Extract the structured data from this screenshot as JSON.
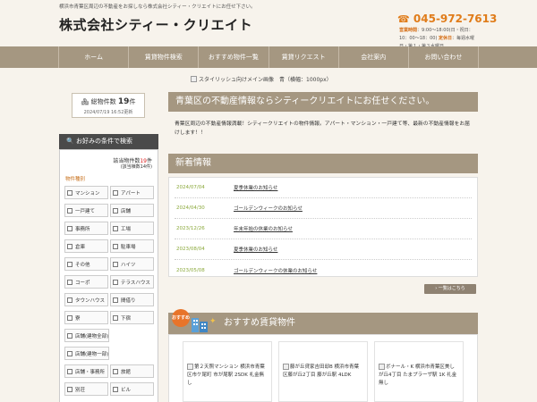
{
  "header": {
    "tagline": "横浜市青葉区周辺の不動産をお探しなら株式会社シティー・クリエイトにお任せ下さい。",
    "company": "株式会社シティー・クリエイト",
    "phone": "045-972-7613",
    "hours_label": "営業時間",
    "hours_text": "：9:00～18:00(日・祝日：10：00～18：00)",
    "holiday_label": "定休日",
    "holiday_text": "：毎週水曜日・第１・第３水曜日"
  },
  "nav": {
    "items": [
      "ホーム",
      "賃貸物件検索",
      "おすすめ物件一覧",
      "賃貸リクエスト",
      "会社案内",
      "お問い合わせ"
    ]
  },
  "hero": {
    "alt": "スタイリッシュ向けメイン画像　青（横幅：1000px）"
  },
  "count_box": {
    "label": "総物件数",
    "count": "19",
    "unit": "件",
    "updated": "2024/07/19 16:52更新"
  },
  "conditions": {
    "title": "お好みの条件で検索",
    "result_prefix": "該当物件数",
    "result_count": "19",
    "result_unit": "件",
    "result_sub": "(該当棟数14件)",
    "category_label": "物件種別",
    "types": [
      "マンション",
      "アパート",
      "一戸建て",
      "店舗",
      "事務所",
      "工場",
      "倉庫",
      "駐車場",
      "その他",
      "ハイツ",
      "コーポ",
      "テラスハウス",
      "タウンハウス",
      "間借り",
      "寮",
      "下宿",
      "店舗(建物全部)",
      "店舗(建物一部)",
      "店舗・事務所",
      "旅館",
      "別荘",
      "ビル"
    ]
  },
  "intro": {
    "title": "青葉区の不動産情報ならシティークリエイトにお任せください。",
    "text": "青葉区周辺の不動産情報満載！シティークリエイトの物件情報。アパート・マンション・一戸建て等、最新の不動産情報をお届けします！！"
  },
  "news": {
    "title": "新着情報",
    "items": [
      {
        "date": "2024/07/04",
        "title": "夏季休業のお知らせ"
      },
      {
        "date": "2024/04/30",
        "title": "ゴールデンウィークのお知らせ"
      },
      {
        "date": "2023/12/26",
        "title": "年末年始の休業のお知らせ"
      },
      {
        "date": "2023/08/04",
        "title": "夏季休業のお知らせ"
      },
      {
        "date": "2023/05/08",
        "title": "ゴールデンウィークの休業のお知らせ"
      }
    ],
    "more": "一覧はこちら"
  },
  "recommend": {
    "badge": "おすすめ",
    "title": "おすすめ賃貸物件",
    "cards": [
      "第２天照マンション 横浜市青葉区市ケ尾町 市が尾駅 2SDK 礼金無し",
      "藤が丘貸家吉田邸B 横浜市青葉区藤が丘2丁目 藤が丘駅 4LDK",
      "ボナール・K 横浜市青葉区美しが丘4丁目 たまプラーザ駅 1K 礼金無し"
    ]
  },
  "colors": {
    "nav_bg": "#a59781",
    "accent_orange": "#e07c1a",
    "date_green": "#8aa83a"
  }
}
